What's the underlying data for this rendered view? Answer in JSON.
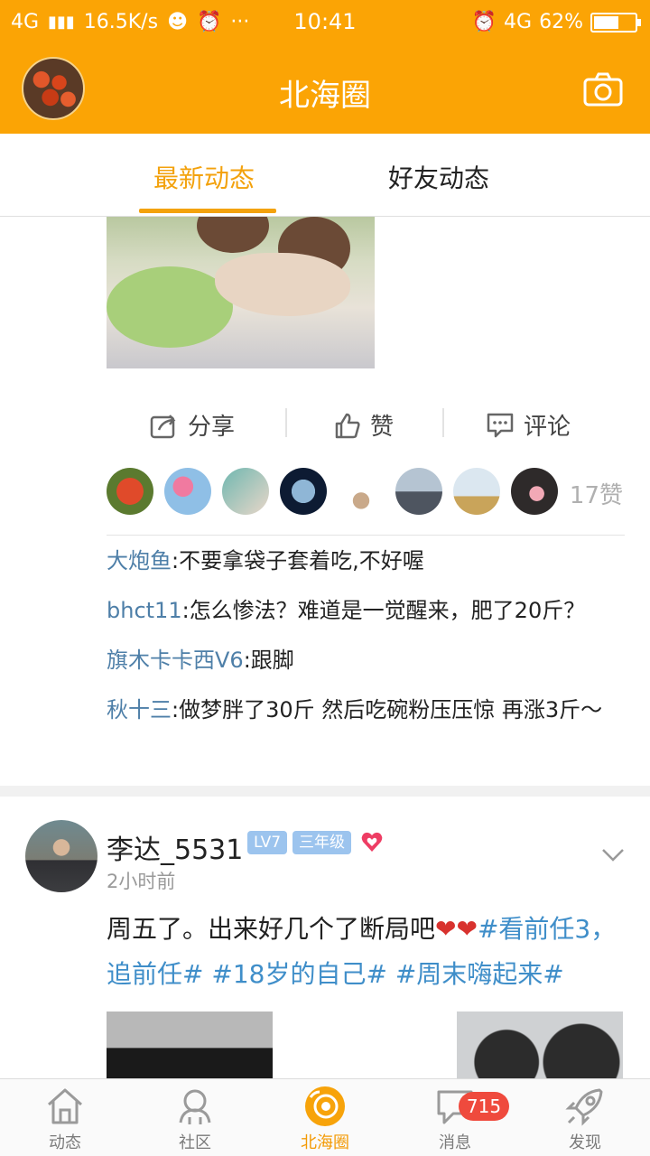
{
  "status_bar": {
    "network_left": "4G",
    "speed": "16.5K/s",
    "more": "···",
    "time": "10:41",
    "network_right": "4G",
    "battery": "62%",
    "battery_level": 0.62
  },
  "header": {
    "title": "北海圈"
  },
  "tabs": [
    {
      "label": "最新动态",
      "active": true
    },
    {
      "label": "好友动态",
      "active": false
    }
  ],
  "post1": {
    "actions": {
      "share": "分享",
      "like": "赞",
      "comment": "评论"
    },
    "like_count": "17赞",
    "comments": [
      {
        "name": "大炮鱼",
        "sep": ":",
        "text": "不要拿袋子套着吃,不好喔"
      },
      {
        "name": "bhct11",
        "sep": ":",
        "text": "怎么惨法？难道是一觉醒来，肥了20斤？"
      },
      {
        "name": "旗木卡卡西V6",
        "sep": ":",
        "text": "跟脚"
      },
      {
        "name": "秋十三",
        "sep": ":",
        "text": "做梦胖了30斤 然后吃碗粉压压惊 再涨3斤～"
      }
    ]
  },
  "post2": {
    "username": "李达_5531",
    "level": "LV7",
    "grade": "三年级",
    "time": "2小时前",
    "text": "周五了。出来好几个了断局吧",
    "tags": [
      "#看前任3，追前任#",
      "#18岁的自己#",
      "#周末嗨起来#"
    ]
  },
  "bottom_nav": [
    {
      "label": "动态",
      "icon": "home-icon",
      "active": false
    },
    {
      "label": "社区",
      "icon": "community-icon",
      "active": false
    },
    {
      "label": "北海圈",
      "icon": "circle-icon",
      "active": true
    },
    {
      "label": "消息",
      "icon": "message-icon",
      "active": false,
      "badge": "715"
    },
    {
      "label": "发现",
      "icon": "rocket-icon",
      "active": false
    }
  ],
  "colors": {
    "brand": "#fba405",
    "accent": "#f3a20d",
    "link": "#4e7fa8",
    "tag": "#3f8ec9",
    "badge": "#ef4a3d"
  }
}
